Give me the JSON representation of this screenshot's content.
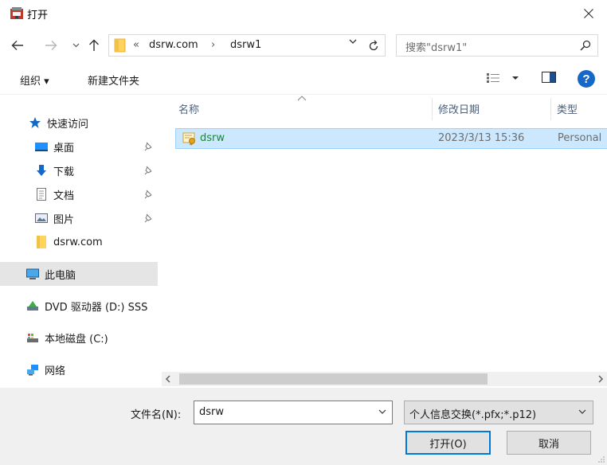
{
  "window": {
    "title": "打开"
  },
  "address": {
    "overflow": "«",
    "crumbs": [
      "dsrw.com",
      "dsrw1"
    ],
    "separator": "›"
  },
  "search": {
    "placeholder": "搜索\"dsrw1\""
  },
  "toolbar": {
    "organize": "组织 ▾",
    "new_folder": "新建文件夹"
  },
  "navpane": {
    "quick_access": "快速访问",
    "items": [
      {
        "label": "桌面",
        "icon": "desktop-icon"
      },
      {
        "label": "下载",
        "icon": "download-icon"
      },
      {
        "label": "文档",
        "icon": "document-icon"
      },
      {
        "label": "图片",
        "icon": "picture-icon"
      },
      {
        "label": "dsrw.com",
        "icon": "folder-icon"
      }
    ],
    "this_pc": "此电脑",
    "dvd": "DVD 驱动器 (D:) SSS",
    "local_disk": "本地磁盘 (C:)",
    "network": "网络"
  },
  "columns": {
    "name": "名称",
    "modified": "修改日期",
    "type": "类型"
  },
  "files": [
    {
      "name": "dsrw",
      "modified": "2023/3/13 15:36",
      "type": "Personal"
    }
  ],
  "footer": {
    "filename_label": "文件名(N):",
    "filename_value": "dsrw",
    "filetype_value": "个人信息交换(*.pfx;*.p12)",
    "open_button": "打开(O)",
    "cancel_button": "取消"
  },
  "colors": {
    "accent": "#0078d7",
    "selection": "#cce8ff",
    "file_green": "#198a2d"
  }
}
